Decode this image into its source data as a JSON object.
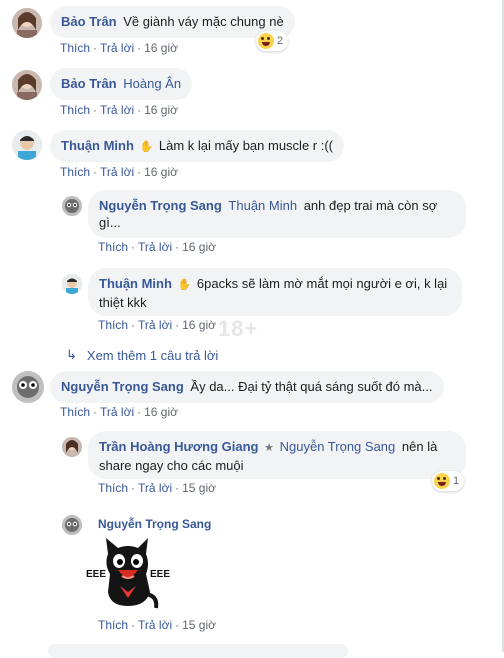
{
  "comments": [
    {
      "author": "Bảo Trân",
      "text": "Về giành váy mặc chung nè",
      "like": "Thích",
      "reply": "Trả lời",
      "time": "16 giờ",
      "reaction_count": "2"
    },
    {
      "author": "Bảo Trân",
      "tag": "Hoàng Ân",
      "like": "Thích",
      "reply": "Trả lời",
      "time": "16 giờ"
    },
    {
      "author": "Thuận Minh",
      "text": "Làm k lại mấy bạn muscle r :((",
      "like": "Thích",
      "reply": "Trả lời",
      "time": "16 giờ",
      "replies": [
        {
          "author": "Nguyễn Trọng Sang",
          "tag": "Thuận Minh",
          "text_line1": "anh đẹp trai mà còn sợ",
          "text_line2": "gì...",
          "like": "Thích",
          "reply": "Trả lời",
          "time": "16 giờ"
        },
        {
          "author": "Thuận Minh",
          "text_line1": "6packs sẽ làm mờ mắt mọi người e ơi, k lại",
          "text_line2": "thiệt kkk",
          "like": "Thích",
          "reply": "Trả lời",
          "time": "16 giờ"
        }
      ],
      "more_replies": "Xem thêm 1 câu trả lời"
    },
    {
      "author": "Nguyễn Trọng Sang",
      "text": "Ầy da... Đại tỷ thật quá sáng suốt đó mà...",
      "like": "Thích",
      "reply": "Trả lời",
      "time": "16 giờ",
      "replies": [
        {
          "author": "Trần Hoàng Hương Giang",
          "tag": "Nguyễn Trọng Sang",
          "text_line1": "nên là",
          "text_line2": "share ngay cho các muội",
          "like": "Thích",
          "reply": "Trả lời",
          "time": "15 giờ",
          "reaction_count": "1"
        },
        {
          "author": "Nguyễn Trọng Sang",
          "sticker": "black-cat-sticker",
          "like": "Thích",
          "reply": "Trả lời",
          "time": "15 giờ"
        }
      ]
    }
  ],
  "colors": {
    "name_blue": "#385898",
    "bubble_bg": "#f2f3f5",
    "meta_gray": "#606770",
    "reaction_yellow": "#fcd34d"
  },
  "icons": [
    "wave-icon",
    "haha-reaction-icon",
    "reply-arrow-icon",
    "star-icon"
  ]
}
